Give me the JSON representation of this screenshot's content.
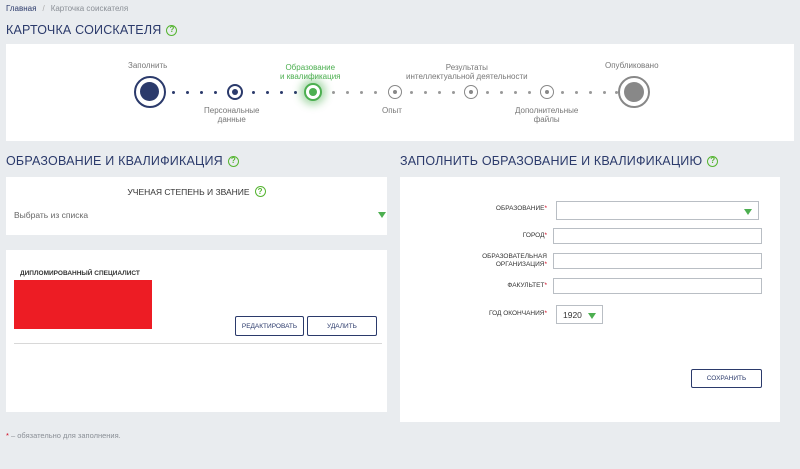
{
  "breadcrumb": {
    "home": "Главная",
    "separator": "/",
    "current": "Карточка соискателя"
  },
  "page_title": "КАРТОЧКА СОИСКАТЕЛЯ",
  "help_glyph": "?",
  "stepper": {
    "steps": [
      {
        "label": "Заполнить",
        "state": "done"
      },
      {
        "label": "Персональные данные",
        "state": "done"
      },
      {
        "label": "Образование и квалификация",
        "state": "active"
      },
      {
        "label": "Опыт",
        "state": "pending"
      },
      {
        "label": "Результаты интеллектуальной деятельности",
        "state": "pending"
      },
      {
        "label": "Дополнительные файлы",
        "state": "pending"
      },
      {
        "label": "Опубликовано",
        "state": "pending"
      }
    ]
  },
  "education_section": {
    "title": "ОБРАЗОВАНИЕ И КВАЛИФИКАЦИЯ",
    "degree_title": "УЧЕНАЯ СТЕПЕНЬ И ЗВАНИЕ",
    "degree_placeholder": "Выбрать из списка",
    "record": {
      "title": "ДИПЛОМИРОВАННЫЙ СПЕЦИАЛИСТ",
      "edit_label": "РЕДАКТИРОВАТЬ",
      "delete_label": "УДАЛИТЬ"
    }
  },
  "form": {
    "title": "ЗАПОЛНИТЬ ОБРАЗОВАНИЕ И КВАЛИФИКАЦИЮ",
    "education_label": "ОБРАЗОВАНИЕ",
    "city_label": "ГОРОД",
    "org_label_line1": "ОБРАЗОВАТЕЛЬНАЯ",
    "org_label_line2": "ОРГАНИЗАЦИЯ",
    "faculty_label": "ФАКУЛЬТЕТ",
    "year_label": "ГОД ОКОНЧАНИЯ",
    "year_value": "1920",
    "required_mark": "*",
    "save_label": "СОХРАНИТЬ"
  },
  "footnote": {
    "mark": "*",
    "text": " – обязательно для заполнения."
  },
  "colors": {
    "navy": "#2b3a6b",
    "green": "#4caf50",
    "required": "#d0021b",
    "redaction": "#ed1c24"
  }
}
